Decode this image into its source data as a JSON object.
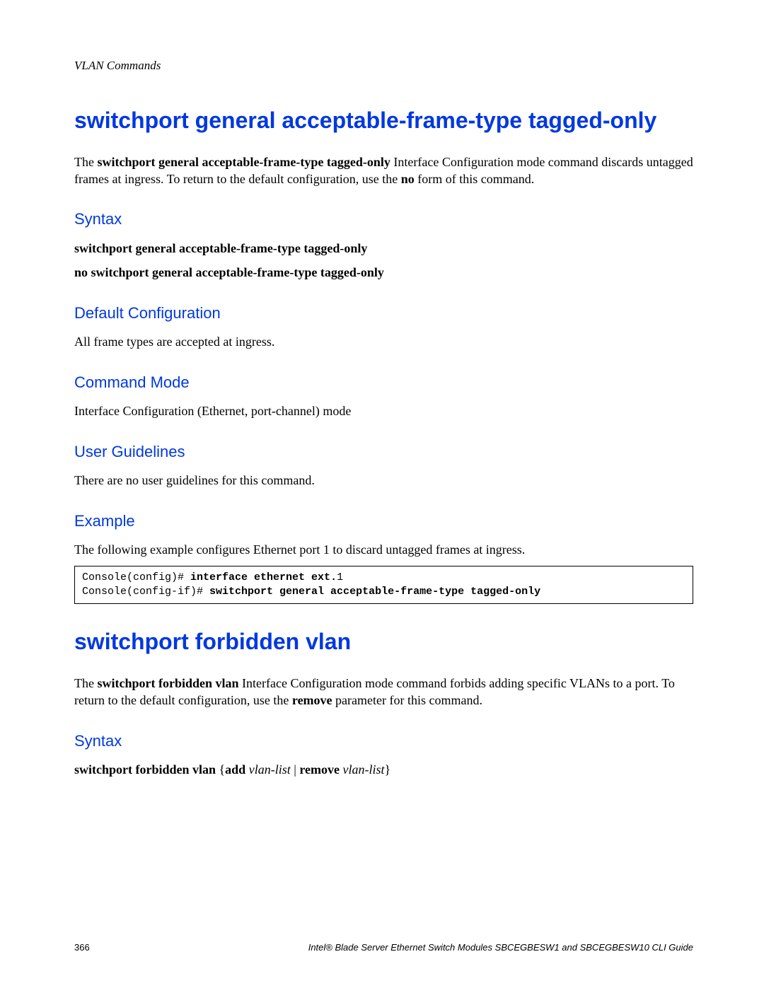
{
  "chapterHeader": "VLAN Commands",
  "section1": {
    "title": "switchport general acceptable-frame-type tagged-only",
    "intro_pre": "The ",
    "intro_cmd": "switchport general acceptable-frame-type tagged-only",
    "intro_mid": " Interface Configuration mode command discards untagged frames at ingress. To return to the default configuration, use the ",
    "intro_no": "no",
    "intro_post": " form of this command.",
    "syntaxLabel": "Syntax",
    "syntax1": "switchport general acceptable-frame-type tagged-only",
    "syntax2": "no switchport general acceptable-frame-type tagged-only",
    "defaultLabel": "Default Configuration",
    "defaultText": "All frame types are accepted at ingress.",
    "commandModeLabel": "Command Mode",
    "commandModeText": "Interface Configuration (Ethernet, port-channel) mode",
    "userGuidelinesLabel": "User Guidelines",
    "userGuidelinesText": "There are no user guidelines for this command.",
    "exampleLabel": "Example",
    "exampleText": "The following example configures Ethernet port 1 to discard untagged frames at ingress.",
    "code": {
      "l1a": "Console(config)# ",
      "l1b": "interface ethernet ext.",
      "l1c": "1",
      "l2a": "Console(config-if)# ",
      "l2b": "switchport general acceptable-frame-type tagged-only"
    }
  },
  "section2": {
    "title": "switchport forbidden vlan",
    "intro_pre": "The ",
    "intro_cmd": "switchport forbidden vlan",
    "intro_mid": " Interface Configuration mode command forbids adding specific VLANs to a port. To return to the default configuration, use the ",
    "intro_remove": "remove",
    "intro_post": " parameter for this command.",
    "syntaxLabel": "Syntax",
    "syntax": {
      "p1": "switchport forbidden vlan",
      "p2": " {",
      "p3": "add",
      "p4": " ",
      "p5": "vlan-list",
      "p6": " | ",
      "p7": "remove",
      "p8": " ",
      "p9": "vlan-list",
      "p10": "}"
    }
  },
  "footer": {
    "pageNumber": "366",
    "guide": "Intel® Blade Server Ethernet Switch Modules SBCEGBESW1 and SBCEGBESW10 CLI Guide"
  }
}
